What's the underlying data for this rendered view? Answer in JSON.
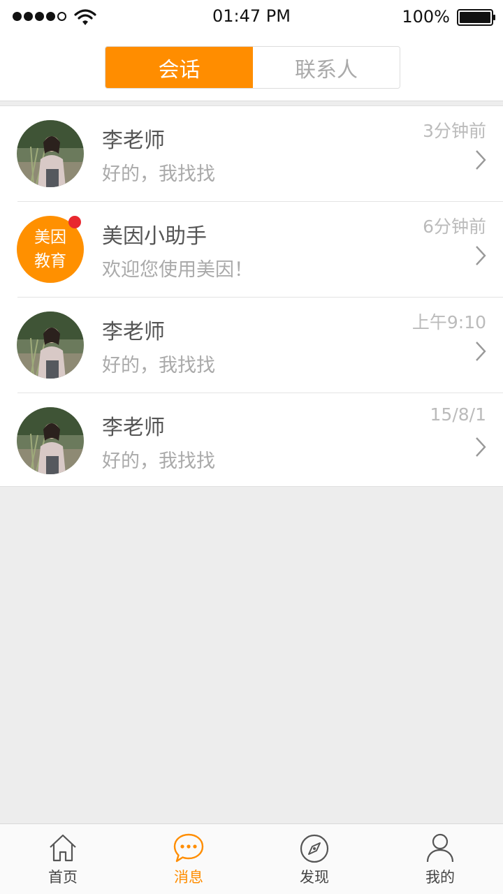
{
  "status_bar": {
    "time": "01:47 PM",
    "battery": "100%",
    "icons": [
      "signal-dots-icon",
      "wifi-icon",
      "battery-icon"
    ]
  },
  "header": {
    "tabs": [
      {
        "label": "会话",
        "active": true
      },
      {
        "label": "联系人",
        "active": false
      }
    ]
  },
  "conversations": [
    {
      "name": "李老师",
      "message": "好的，我找找",
      "time": "3分钟前",
      "avatar": "photo",
      "unread": false
    },
    {
      "name": "美因小助手",
      "message": "欢迎您使用美因！",
      "time": "6分钟前",
      "avatar": "brand",
      "avatar_text": [
        "美因",
        "教育"
      ],
      "unread": true
    },
    {
      "name": "李老师",
      "message": "好的，我找找",
      "time": "上午9:10",
      "avatar": "photo",
      "unread": false
    },
    {
      "name": "李老师",
      "message": "好的，我找找",
      "time": "15/8/1",
      "avatar": "photo",
      "unread": false
    }
  ],
  "tabbar": [
    {
      "label": "首页",
      "icon": "home-icon",
      "active": false
    },
    {
      "label": "消息",
      "icon": "message-icon",
      "active": true
    },
    {
      "label": "发现",
      "icon": "compass-icon",
      "active": false
    },
    {
      "label": "我的",
      "icon": "person-icon",
      "active": false
    }
  ],
  "colors": {
    "accent": "#ff8d00",
    "badge": "#e8282f",
    "background": "#ededed"
  }
}
